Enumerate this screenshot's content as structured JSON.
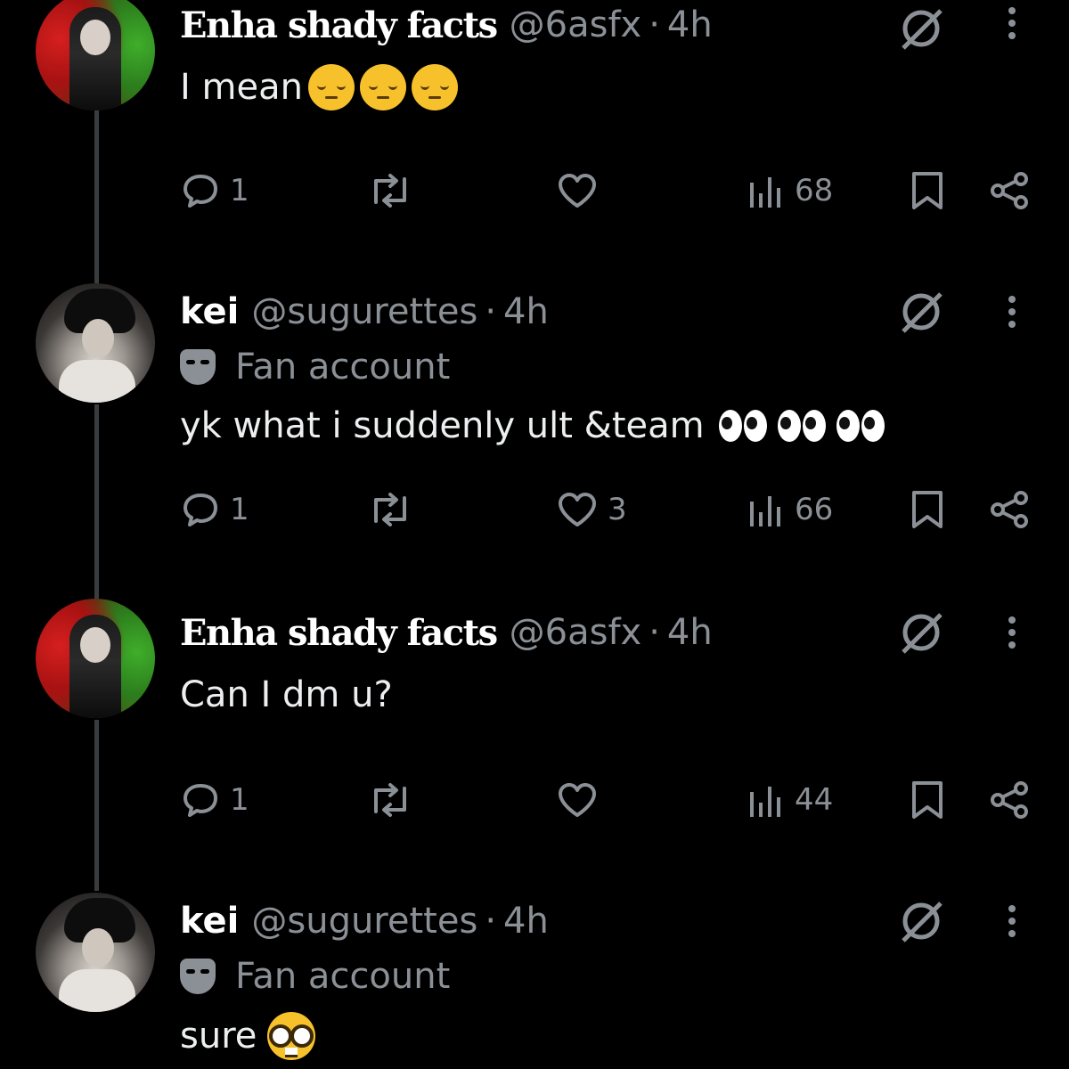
{
  "tweets": [
    {
      "author": "Enha shady facts",
      "handle": "@6asfx",
      "separator": "·",
      "time": "4h",
      "text": "I mean",
      "emoji": [
        "pensive-face",
        "pensive-face",
        "pensive-face"
      ],
      "replies": "1",
      "retweets": "",
      "likes": "",
      "views": "68"
    },
    {
      "author": "kei",
      "handle": "@sugurettes",
      "separator": "·",
      "time": "4h",
      "label": "Fan account",
      "text": "yk what i suddenly ult &team",
      "emoji": [
        "eyes",
        "eyes",
        "eyes"
      ],
      "replies": "1",
      "retweets": "",
      "likes": "3",
      "views": "66"
    },
    {
      "author": "Enha shady facts",
      "handle": "@6asfx",
      "separator": "·",
      "time": "4h",
      "text": "Can I dm u?",
      "replies": "1",
      "retweets": "",
      "likes": "",
      "views": "44"
    },
    {
      "author": "kei",
      "handle": "@sugurettes",
      "separator": "·",
      "time": "4h",
      "label": "Fan account",
      "text": "sure",
      "emoji": [
        "nerd-face"
      ]
    }
  ],
  "colors": {
    "background": "#000000",
    "text": "#e7e9ea",
    "muted": "#8b9096",
    "emoji_yellow": "#f7c12c"
  }
}
